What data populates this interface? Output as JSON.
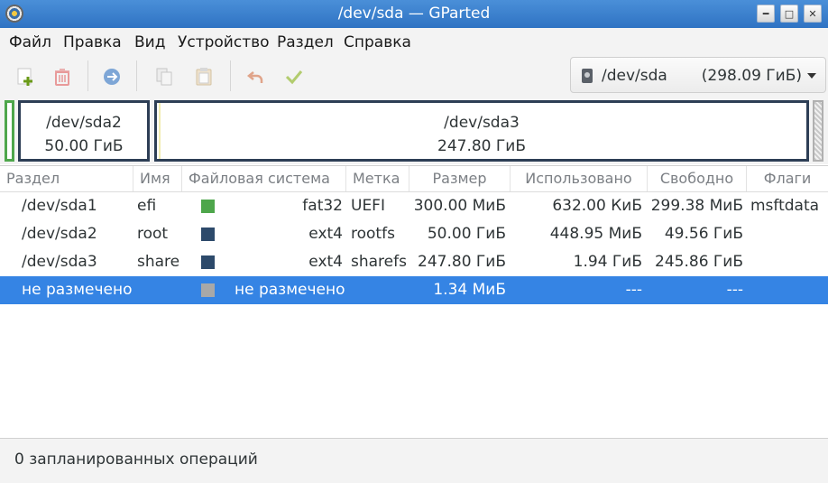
{
  "window": {
    "title": "/dev/sda — GParted"
  },
  "menu": [
    "Файл",
    "Правка",
    "Вид",
    "Устройство",
    "Раздел",
    "Справка"
  ],
  "toolbar": {
    "buttons": [
      "new-icon",
      "delete-icon",
      "resize-move-icon",
      "copy-icon",
      "paste-icon",
      "undo-icon",
      "apply-icon"
    ]
  },
  "device": {
    "name": "/dev/sda",
    "size": "(298.09 ГиБ)"
  },
  "diskmap": [
    {
      "name": "/dev/sda2",
      "size": "50.00 ГиБ",
      "color": "#2d3e55"
    },
    {
      "name": "/dev/sda3",
      "size": "247.80 ГиБ",
      "color": "#2d3e55"
    }
  ],
  "table": {
    "headers": [
      "Раздел",
      "Имя",
      "Файловая система",
      "Метка",
      "Размер",
      "Использовано",
      "Свободно",
      "Флаги"
    ],
    "rows": [
      {
        "partition": "/dev/sda1",
        "name": "efi",
        "color": "#4ea64b",
        "fs": "fat32",
        "label": "UEFI",
        "size": "300.00 МиБ",
        "used": "632.00 КиБ",
        "free": "299.38 МиБ",
        "flags": "msftdata"
      },
      {
        "partition": "/dev/sda2",
        "name": "root",
        "color": "#2d4a6b",
        "fs": "ext4",
        "label": "rootfs",
        "size": "50.00 ГиБ",
        "used": "448.95 МиБ",
        "free": "49.56 ГиБ",
        "flags": ""
      },
      {
        "partition": "/dev/sda3",
        "name": "share",
        "color": "#2d4a6b",
        "fs": "ext4",
        "label": "sharefs",
        "size": "247.80 ГиБ",
        "used": "1.94 ГиБ",
        "free": "245.86 ГиБ",
        "flags": ""
      },
      {
        "partition": "не размечено",
        "name": "",
        "color": "#a8a8a8",
        "fs": "не размечено",
        "label": "",
        "size": "1.34 МиБ",
        "used": "---",
        "free": "---",
        "flags": ""
      }
    ]
  },
  "status": {
    "text": "0 запланированных операций"
  }
}
